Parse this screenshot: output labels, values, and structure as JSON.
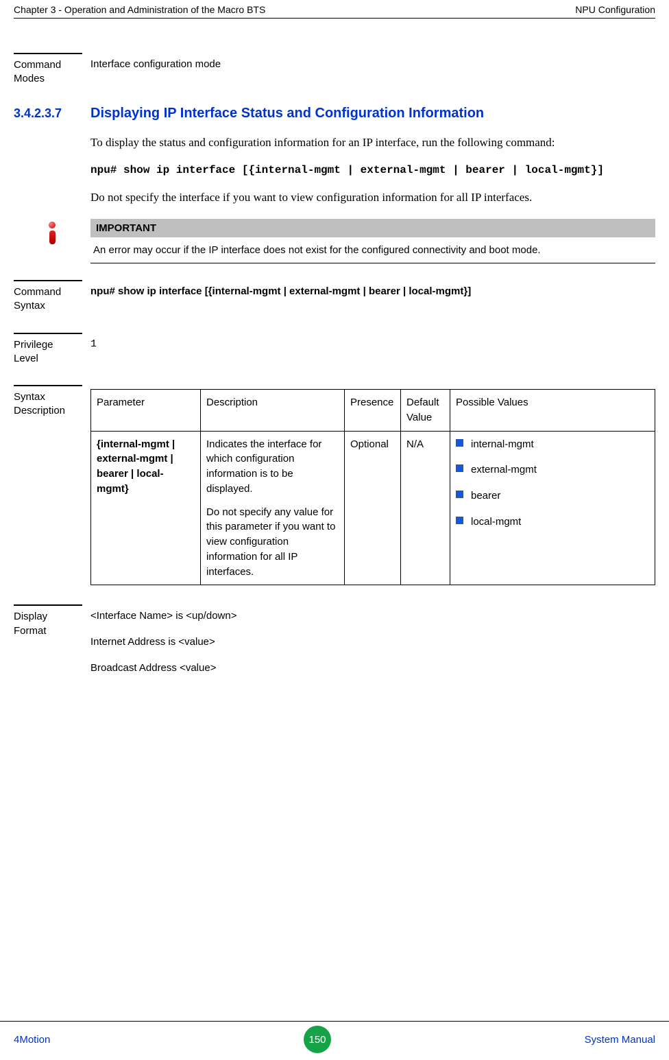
{
  "header": {
    "left": "Chapter 3 - Operation and Administration of the Macro BTS",
    "right": "NPU Configuration"
  },
  "cmd_modes": {
    "label_l1": "Command",
    "label_l2": "Modes",
    "value": "Interface configuration mode"
  },
  "section": {
    "num": "3.4.2.3.7",
    "title": "Displaying IP Interface Status and Configuration Information",
    "intro": "To display the status and configuration information for an IP interface, run the following command:",
    "command": "npu# show ip interface [{internal-mgmt | external-mgmt | bearer | local-mgmt}]",
    "note": "Do not specify the interface if you want to view configuration information for all IP interfaces."
  },
  "important": {
    "label": "IMPORTANT",
    "text": "An error may occur if the IP interface does not exist for the configured connectivity and boot mode."
  },
  "cmd_syntax": {
    "label_l1": "Command",
    "label_l2": "Syntax",
    "value": "npu# show ip interface [{internal-mgmt | external-mgmt | bearer | local-mgmt}]"
  },
  "priv": {
    "label_l1": "Privilege",
    "label_l2": "Level",
    "value": "1"
  },
  "syntax_desc": {
    "label_l1": "Syntax",
    "label_l2": "Description",
    "headers": {
      "param": "Parameter",
      "desc": "Description",
      "presence": "Presence",
      "default": "Default Value",
      "possible": "Possible Values"
    },
    "row": {
      "param": "{internal-mgmt | external-mgmt | bearer | local-mgmt}",
      "desc_p1": "Indicates the interface for which configuration information is to be displayed.",
      "desc_p2": "Do not specify any value for this parameter if you want to view configuration information for all IP interfaces.",
      "presence": "Optional",
      "default": "N/A",
      "possible": [
        "internal-mgmt",
        "external-mgmt",
        "bearer",
        "local-mgmt"
      ]
    }
  },
  "display_format": {
    "label_l1": "Display",
    "label_l2": "Format",
    "lines": [
      "<Interface Name> is <up/down>",
      "Internet Address is <value>",
      "Broadcast Address <value>"
    ]
  },
  "footer": {
    "left": "4Motion",
    "page": "150",
    "right": "System Manual"
  }
}
